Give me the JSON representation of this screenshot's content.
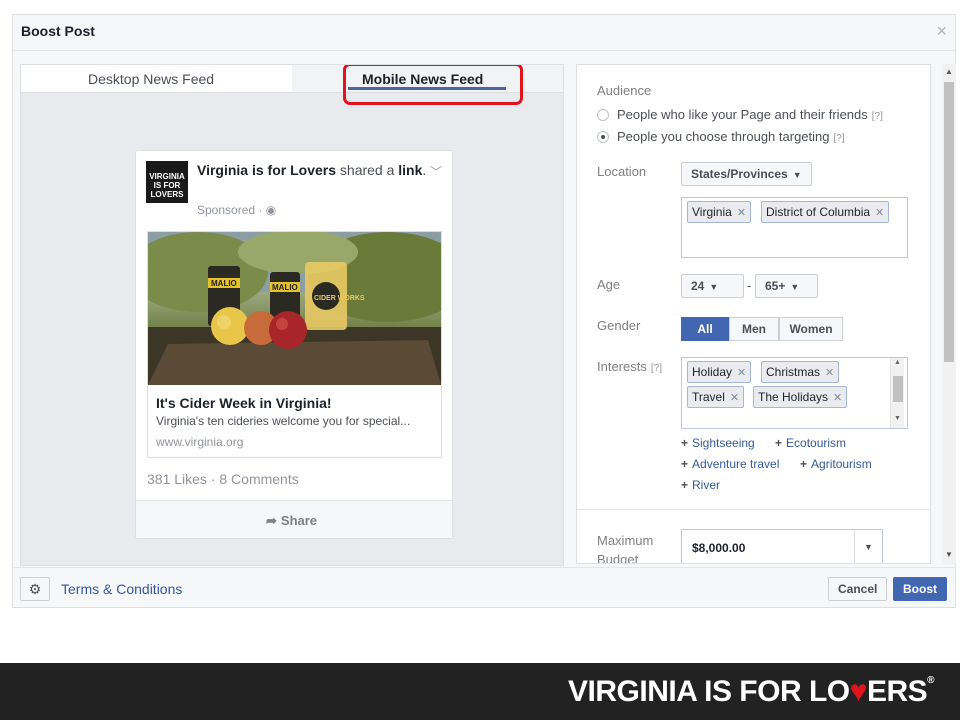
{
  "dialog": {
    "title": "Boost Post",
    "close": "×"
  },
  "preview": {
    "tabs": {
      "desktop": "Desktop News Feed",
      "mobile": "Mobile News Feed"
    },
    "post": {
      "logo_text": "VIRGINIA IS FOR LOVERS",
      "page_name": "Virginia is for Lovers",
      "action": "shared a",
      "action_link": "link",
      "sponsored": "Sponsored · ◉",
      "link_title": "It's Cider Week in Virginia!",
      "link_desc": "Virginia's ten cideries welcome you for special...",
      "link_url": "www.virginia.org",
      "image_texts": {
        "can_label": "MALIO",
        "glass_label": "CIDER WORKS"
      },
      "stats": "381 Likes · 8 Comments",
      "share": "Share"
    }
  },
  "settings": {
    "audience": {
      "label": "Audience",
      "options": [
        {
          "label": "People who like your Page and their friends",
          "help": "[?]",
          "selected": false
        },
        {
          "label": "People you choose through targeting",
          "help": "[?]",
          "selected": true
        }
      ]
    },
    "location": {
      "label": "Location",
      "dropdown": "States/Provinces",
      "tags": [
        "Virginia",
        "District of Columbia"
      ]
    },
    "age": {
      "label": "Age",
      "min": "24",
      "max": "65+",
      "separator": "-"
    },
    "gender": {
      "label": "Gender",
      "options": [
        "All",
        "Men",
        "Women"
      ],
      "selected": "All"
    },
    "interests": {
      "label": "Interests",
      "help": "[?]",
      "tags": [
        "Holiday",
        "Christmas",
        "Travel",
        "The Holidays"
      ],
      "suggestions": [
        "Sightseeing",
        "Ecotourism",
        "Adventure travel",
        "Agritourism",
        "River"
      ]
    },
    "budget": {
      "label_line1": "Maximum",
      "label_line2": "Budget",
      "value": "$8,000.00"
    }
  },
  "footer": {
    "terms": "Terms & Conditions",
    "cancel": "Cancel",
    "boost": "Boost"
  },
  "brand": {
    "text_before": "VIRGINIA IS FOR LO",
    "heart": "♥",
    "text_after": "ERS",
    "reg": "®"
  },
  "colors": {
    "accent": "#4267b2",
    "highlight": "#e1141d",
    "link": "#365899"
  }
}
